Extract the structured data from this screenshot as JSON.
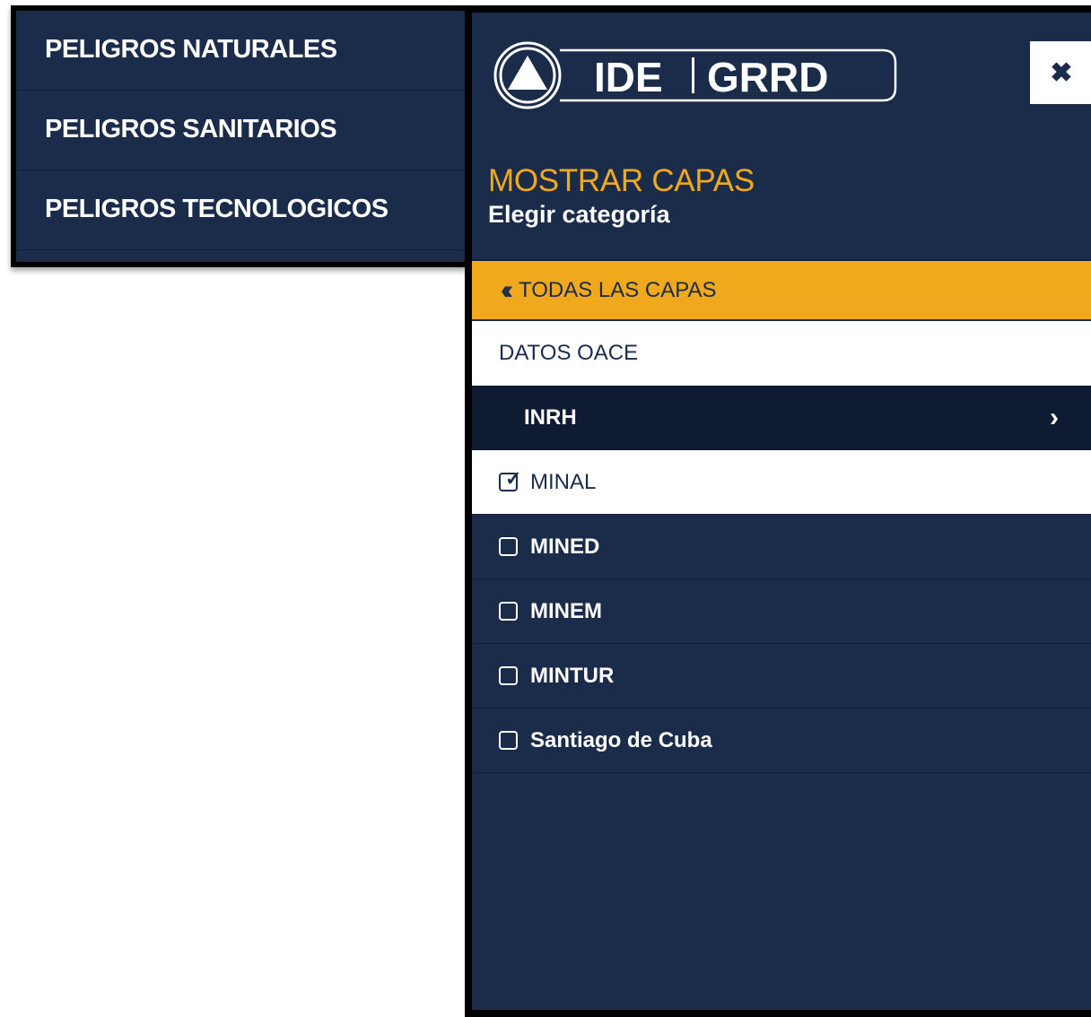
{
  "left_menu": {
    "items": [
      {
        "label": "PELIGROS NATURALES"
      },
      {
        "label": "PELIGROS SANITARIOS"
      },
      {
        "label": "PELIGROS TECNOLOGICOS"
      }
    ]
  },
  "panel": {
    "logo_left": "IDE",
    "logo_right": "GRRD",
    "close_icon": "close-icon",
    "title": "MOSTRAR CAPAS",
    "subtitle": "Elegir categoría",
    "back_label": "TODAS LAS CAPAS",
    "back_icon": "double-chevron-left-icon",
    "group_label": "DATOS OACE",
    "selected_item": "INRH",
    "selected_item_icon": "chevron-right-icon",
    "layers": [
      {
        "label": "MINAL",
        "checked": true
      },
      {
        "label": "MINED",
        "checked": false
      },
      {
        "label": "MINEM",
        "checked": false
      },
      {
        "label": "MINTUR",
        "checked": false
      },
      {
        "label": "Santiago de Cuba",
        "checked": false
      }
    ]
  },
  "colors": {
    "navy": "#1b2c4b",
    "navy_dark": "#0e1b33",
    "accent_orange": "#f0a81d",
    "white": "#ffffff"
  }
}
